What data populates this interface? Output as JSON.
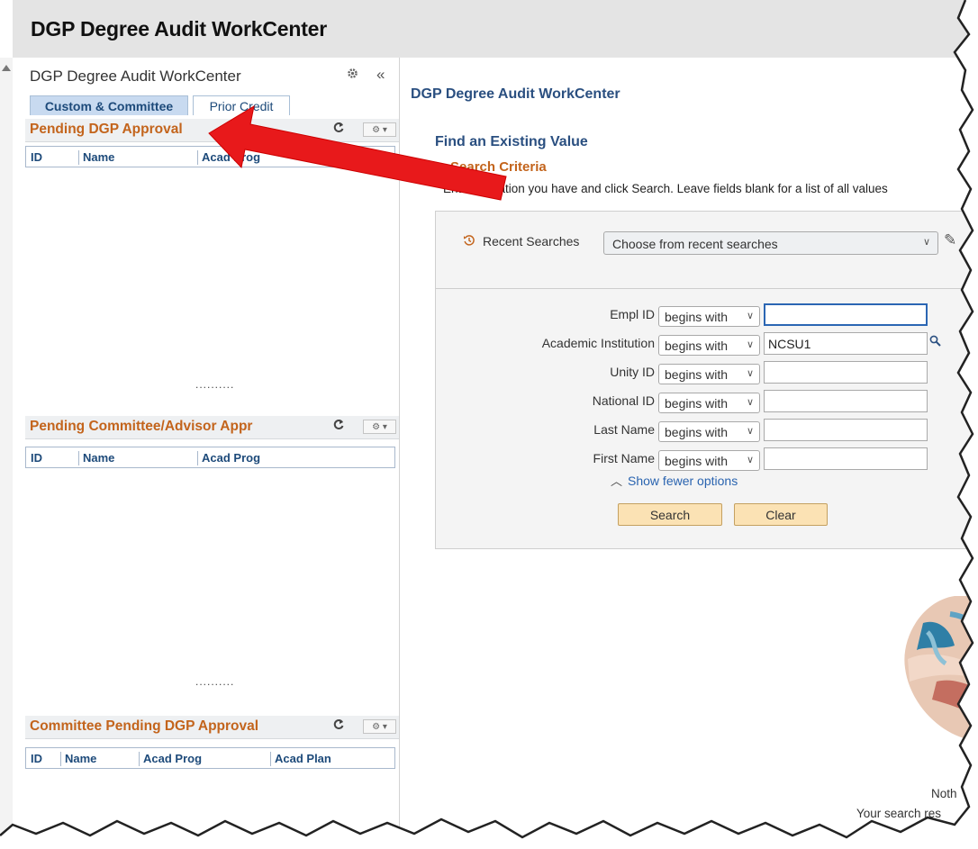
{
  "header": {
    "title": "DGP Degree Audit WorkCenter"
  },
  "sidebar": {
    "title": "DGP Degree Audit WorkCenter",
    "collapse_glyph": "«",
    "tabs": [
      {
        "label": "Custom & Committee",
        "active": true
      },
      {
        "label": "Prior Credit",
        "active": false
      }
    ],
    "pagelets": [
      {
        "title": "Pending DGP Approval",
        "columns": [
          "ID",
          "Name",
          "Acad Prog"
        ]
      },
      {
        "title": "Pending Committee/Advisor Appr",
        "columns": [
          "ID",
          "Name",
          "Acad Prog"
        ]
      },
      {
        "title": "Committee Pending DGP Approval",
        "columns": [
          "ID",
          "Name",
          "Acad Prog",
          "Acad Plan"
        ]
      }
    ],
    "splitter_dots": ".........."
  },
  "main": {
    "title": "DGP Degree Audit WorkCenter",
    "find_title": "Find an Existing Value",
    "criteria_title": "Search Criteria",
    "instructions": "Ent information you have and click Search. Leave fields blank for a list of all values",
    "recent_label": "Recent Searches",
    "recent_placeholder": "Choose from recent searches",
    "fields": [
      {
        "label": "Empl ID",
        "operator": "begins with",
        "value": ""
      },
      {
        "label": "Academic Institution",
        "operator": "begins with",
        "value": "NCSU1"
      },
      {
        "label": "Unity ID",
        "operator": "begins with",
        "value": ""
      },
      {
        "label": "National ID",
        "operator": "begins with",
        "value": ""
      },
      {
        "label": "Last Name",
        "operator": "begins with",
        "value": ""
      },
      {
        "label": "First Name",
        "operator": "begins with",
        "value": ""
      }
    ],
    "fewer_options": "Show fewer options",
    "search_button": "Search",
    "clear_button": "Clear",
    "no_results_1": "Noth",
    "no_results_2": "Your search res"
  },
  "colors": {
    "accent_orange": "#c3641c",
    "link_blue": "#2a4f80",
    "annotation_arrow": "#e8191b",
    "button_fill": "#fbe2b4"
  },
  "icons": {
    "gear": "gear-icon",
    "refresh": "refresh-icon",
    "history": "history-icon",
    "pencil": "pencil-icon",
    "lookup": "magnifier-icon",
    "chevron": "chevron-down-icon"
  }
}
